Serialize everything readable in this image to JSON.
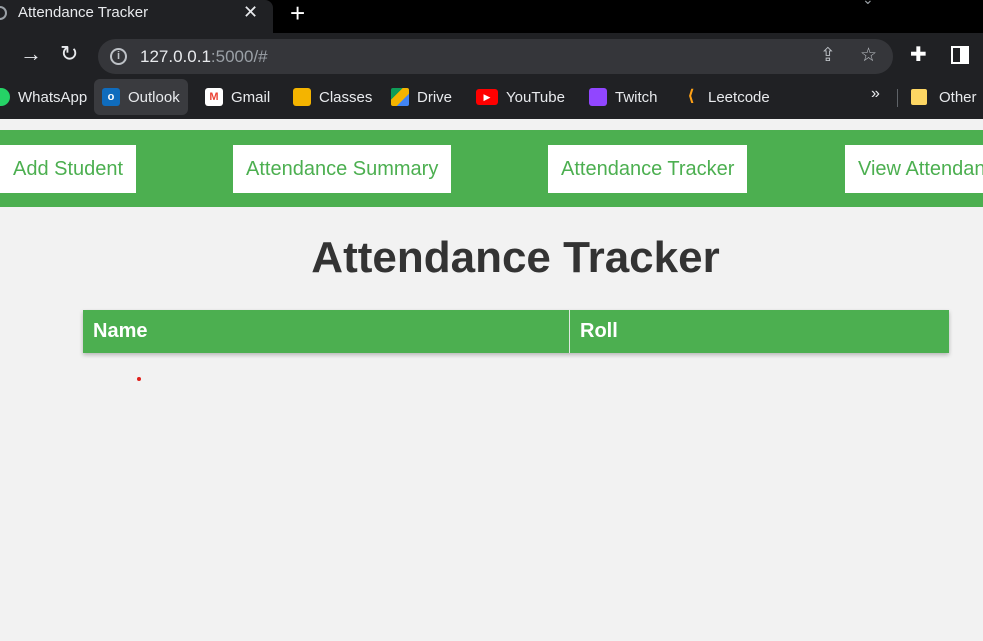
{
  "browser": {
    "tab": {
      "title": "Attendance Tracker"
    },
    "url": {
      "host": "127.0.0.1",
      "rest": ":5000/#"
    },
    "bookmarks": [
      {
        "label": "WhatsApp",
        "icon": "whatsapp-icon"
      },
      {
        "label": "Outlook",
        "icon": "outlook-icon"
      },
      {
        "label": "Gmail",
        "icon": "gmail-icon"
      },
      {
        "label": "Classes",
        "icon": "classes-icon"
      },
      {
        "label": "Drive",
        "icon": "drive-icon"
      },
      {
        "label": "YouTube",
        "icon": "youtube-icon"
      },
      {
        "label": "Twitch",
        "icon": "twitch-icon"
      },
      {
        "label": "Leetcode",
        "icon": "leetcode-icon"
      }
    ],
    "bookmarks_more": "»",
    "other_bookmarks": "Other"
  },
  "navbar": {
    "links": [
      "Add Student",
      "Attendance Summary",
      "Attendance Tracker",
      "View Attendan"
    ]
  },
  "page": {
    "title": "Attendance Tracker",
    "table": {
      "columns": [
        "Name",
        "Roll"
      ]
    }
  },
  "colors": {
    "accent": "#4caf50",
    "page_bg": "#f2f2f2",
    "title_text": "#333333",
    "chrome_bg": "#202124"
  }
}
